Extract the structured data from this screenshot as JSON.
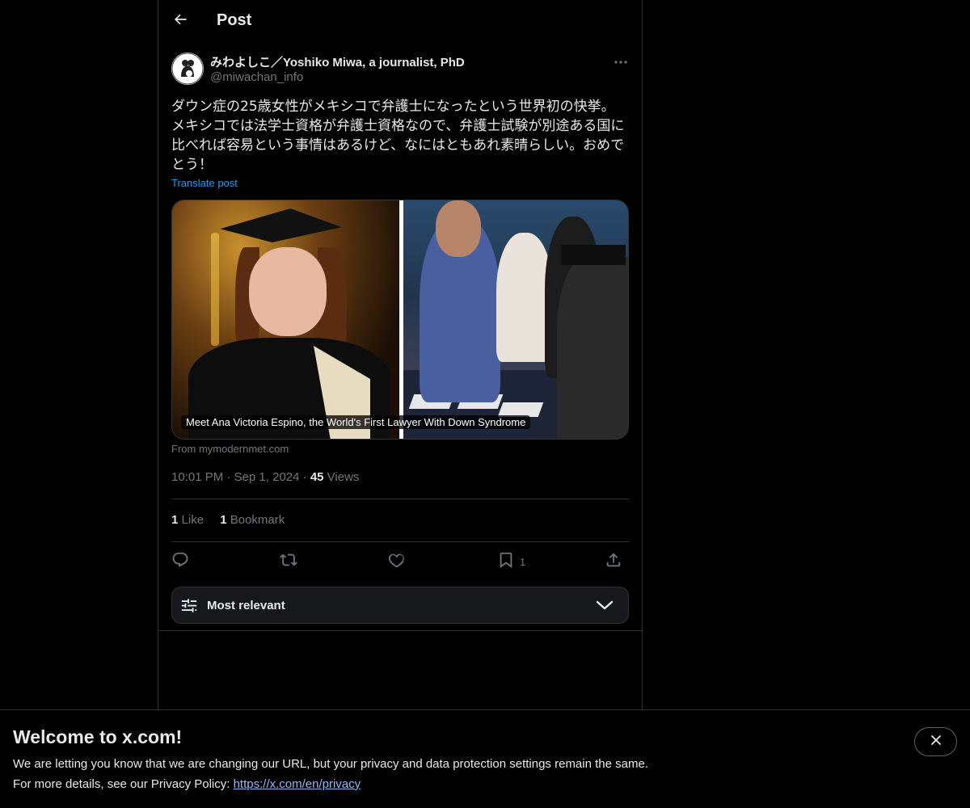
{
  "header": {
    "title": "Post",
    "back_icon": "arrow-left-icon"
  },
  "post": {
    "author": {
      "display_name": "みわよしこ／Yoshiko Miwa, a journalist, PhD",
      "handle": "@miwachan_info"
    },
    "text_lines": [
      "ダウン症の25歳女性がメキシコで弁護士になったという世界初の快挙。",
      "メキシコでは法学士資格が弁護士資格なので、弁護士試験が別途ある国に",
      "比べれば容易という事情はあるけど、なにはともあれ素晴らしい。おめで",
      "とう！"
    ],
    "translate_label": "Translate post",
    "media": {
      "caption": "Meet Ana Victoria Espino, the World's First Lawyer With Down Syndrome"
    },
    "source": "From mymodernmet.com",
    "time": "10:01 PM",
    "date": "Sep 1, 2024",
    "views_count": "45",
    "views_label": "Views",
    "likes_count": "1",
    "likes_label": "Like",
    "bookmarks_count": "1",
    "bookmarks_label": "Bookmark",
    "actions": {
      "reply_icon": "reply-icon",
      "repost_icon": "repost-icon",
      "like_icon": "heart-icon",
      "bookmark_icon": "bookmark-icon",
      "bookmark_count": "1",
      "share_icon": "share-icon"
    }
  },
  "replies_sort": {
    "label": "Most relevant"
  },
  "banner": {
    "title": "Welcome to x.com!",
    "line1": "We are letting you know that we are changing our URL, but your privacy and data protection settings remain the same.",
    "line2_prefix": "For more details, see our Privacy Policy: ",
    "link_text": "https://x.com/en/privacy"
  },
  "colors": {
    "background": "#000000",
    "text": "#e7e9ea",
    "muted": "#71767b",
    "accent": "#1d9bf0",
    "border": "#2f3336"
  }
}
